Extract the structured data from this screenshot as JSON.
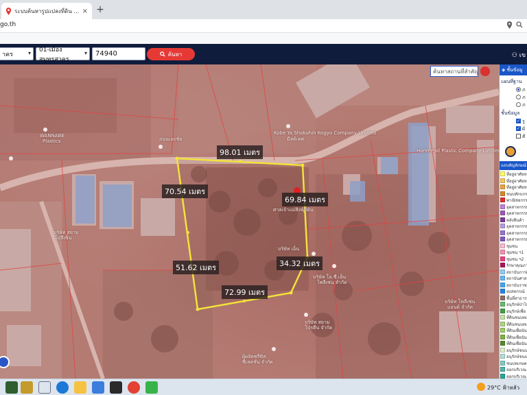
{
  "browser": {
    "tab_title": "ระบบค้นหารูปแปลงที่ดิน (LandsMaps)",
    "tab_close": "×",
    "new_tab": "+",
    "url": "go.th"
  },
  "toolbar": {
    "province": "าคร",
    "district": "01-เมืองสมุทรสาคร",
    "parcel_no": "74940",
    "search_label": "ค้นหา",
    "user_label": "เข"
  },
  "map": {
    "search_placeholder": "ค้นหาสถานที่สำคัญ",
    "measurements": {
      "top": "98.01 เมตร",
      "left_upper": "70.54 เมตร",
      "right_upper": "69.84 เมตร",
      "left_lower": "51.62 เมตร",
      "right_lower": "34.32 เมตร",
      "bottom": "72.99 เมตร"
    },
    "place_labels": {
      "kobe": "Kobe Ya Shokuhin Kogyo Company Limited",
      "kobe_sub": "มีสต์เทศ",
      "wannabe": "WANNABE",
      "wannabe_sub": "Plastics",
      "hunmead": "Hunmead Plastic Company Limited",
      "parcel_note": "ศาลเจ้าแม่สิงห์ที่ดิน",
      "center_a": "บริษัท เอ็น",
      "center_b": "บริษัท โอ.ซี.เอ็น",
      "center_b2": "โพลีเซ่น จำกัด",
      "south_a": "บริษัท สยาม",
      "south_a2": "โปรตีน จำกัด",
      "south_b": "ผู้ผลิตพรีซิส",
      "south_b2": "ซีเลคชั่น จำกัด",
      "east_a": "บริษัท โพลีเซ่น",
      "east_a2": "แอนด์ จำกัด",
      "west_a": "บริษัท สยาม",
      "west_a2": "โปลีเซ็น",
      "road": "ถนนเอกชัย"
    }
  },
  "panel": {
    "header": "ชั้นข้อมู",
    "base_map_title": "แผนที่ฐาน",
    "base_opts": [
      "ภ",
      "ภ",
      "ภ"
    ],
    "layers_title": "ชั้นข้อมูล",
    "layer_opts": [
      "รู",
      "ผั",
      "ตั"
    ],
    "legend_header": "แถบสัญลักษณ์",
    "legend": [
      {
        "label": "ที่อยู่อาศัยหน",
        "color": "#ffff66"
      },
      {
        "label": "ที่อยู่อาศัยหน",
        "color": "#f5c95a"
      },
      {
        "label": "ที่อยู่อาศัยหน",
        "color": "#e8a53a"
      },
      {
        "label": "ชนบทักบกรม",
        "color": "#d68a2a"
      },
      {
        "label": "พาณิชยกรรมร",
        "color": "#e03030"
      },
      {
        "label": "อุตสาหกรรมฯ",
        "color": "#c080d8"
      },
      {
        "label": "อุตสาหกรรมฯ",
        "color": "#9b59b6"
      },
      {
        "label": "คลังสินค้า",
        "color": "#7d3c98"
      },
      {
        "label": "อุตสาหกรรม",
        "color": "#b39ddb"
      },
      {
        "label": "อุตสาหกรรม",
        "color": "#9575cd"
      },
      {
        "label": "อุตสาหกรรม",
        "color": "#7e57c2"
      },
      {
        "label": "ชุมชน",
        "color": "#f8bbd0"
      },
      {
        "label": "ชุมชน ฯ1",
        "color": "#f48fb1"
      },
      {
        "label": "ชุมชน ฯ2",
        "color": "#ec407a"
      },
      {
        "label": "รักษาคุณภาพ",
        "color": "#ad1457"
      },
      {
        "label": "สถาบันการศึ",
        "color": "#90caf9"
      },
      {
        "label": "สถาบันศาส",
        "color": "#64b5f6"
      },
      {
        "label": "สถาบันราชกา",
        "color": "#42a5f5"
      },
      {
        "label": "สงสหกรณ์",
        "color": "#1e88e5"
      },
      {
        "label": "พื้นที่สาธารณู",
        "color": "#8d6e63"
      },
      {
        "label": "อนุรักษ์ป่าไม้",
        "color": "#66bb6a"
      },
      {
        "label": "อนุรักษ์เพื่อ",
        "color": "#43a047"
      },
      {
        "label": "ที่ดินชนบทแ",
        "color": "#c5e1a5"
      },
      {
        "label": "ที่ดินชนบทแ",
        "color": "#aed581"
      },
      {
        "label": "ที่ดินเพื่อนัน",
        "color": "#9ccc65"
      },
      {
        "label": "ที่ดินเพื่อนัน",
        "color": "#7cb342"
      },
      {
        "label": "ที่ดินเพื่อนัน",
        "color": "#558b2f"
      },
      {
        "label": "อนุรักษ์ชนบ",
        "color": "#dcedc8"
      },
      {
        "label": "อนุรักษ์ชนบ",
        "color": "#b2dfdb"
      },
      {
        "label": "ชนบทเกษตร",
        "color": "#80cbc4"
      },
      {
        "label": "ลอกบริเวณ",
        "color": "#4db6ac"
      },
      {
        "label": "ลอกบริเวณ",
        "color": "#26a69a"
      }
    ]
  },
  "taskbar": {
    "weather": "29°C ฟ้าหลัว"
  }
}
